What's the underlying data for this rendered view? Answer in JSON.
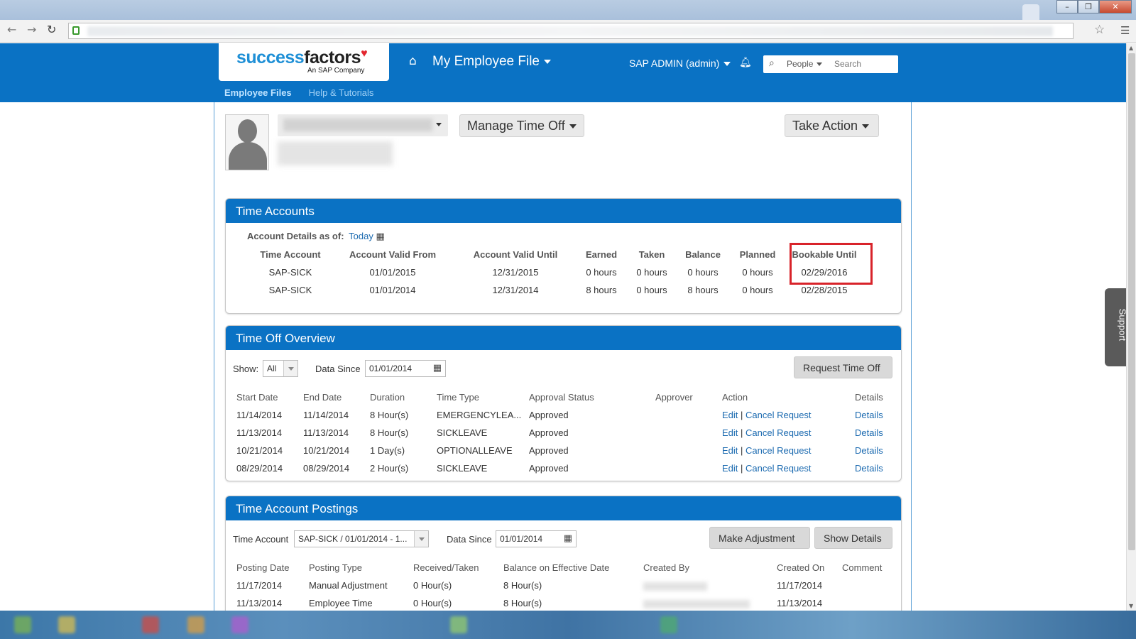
{
  "header": {
    "logo_main_a": "success",
    "logo_main_b": "factors",
    "logo_sub": "An SAP Company",
    "module_title": "My Employee File",
    "user_label": "SAP ADMIN (admin)",
    "search_scope": "People",
    "search_placeholder": "Search",
    "subnav": [
      "Employee Files",
      "Help & Tutorials"
    ]
  },
  "profile": {
    "manage_time_off": "Manage Time Off",
    "take_action": "Take Action"
  },
  "time_accounts": {
    "title": "Time Accounts",
    "as_of_label": "Account Details as of:",
    "as_of_value": "Today",
    "columns": [
      "Time Account",
      "Account Valid From",
      "Account Valid Until",
      "Earned",
      "Taken",
      "Balance",
      "Planned",
      "Bookable Until"
    ],
    "rows": [
      [
        "SAP-SICK",
        "01/01/2015",
        "12/31/2015",
        "0 hours",
        "0 hours",
        "0 hours",
        "0 hours",
        "02/29/2016"
      ],
      [
        "SAP-SICK",
        "01/01/2014",
        "12/31/2014",
        "8 hours",
        "0 hours",
        "8 hours",
        "0 hours",
        "02/28/2015"
      ]
    ]
  },
  "time_off_overview": {
    "title": "Time Off Overview",
    "show_label": "Show:",
    "show_value": "All",
    "data_since_label": "Data Since",
    "data_since_value": "01/01/2014",
    "request_button": "Request Time Off",
    "columns": [
      "Start Date",
      "End Date",
      "Duration",
      "Time Type",
      "Approval Status",
      "Approver",
      "Action",
      "Details"
    ],
    "rows": [
      {
        "start": "11/14/2014",
        "end": "11/14/2014",
        "duration": "8 Hour(s)",
        "type": "EMERGENCYLEA...",
        "status": "Approved",
        "approver": "",
        "edit": "Edit",
        "sep": "|",
        "cancel": "Cancel Request",
        "details": "Details"
      },
      {
        "start": "11/13/2014",
        "end": "11/13/2014",
        "duration": "8 Hour(s)",
        "type": "SICKLEAVE",
        "status": "Approved",
        "approver": "",
        "edit": "Edit",
        "sep": "|",
        "cancel": "Cancel Request",
        "details": "Details"
      },
      {
        "start": "10/21/2014",
        "end": "10/21/2014",
        "duration": "1 Day(s)",
        "type": "OPTIONALLEAVE",
        "status": "Approved",
        "approver": "",
        "edit": "Edit",
        "sep": "|",
        "cancel": "Cancel Request",
        "details": "Details"
      },
      {
        "start": "08/29/2014",
        "end": "08/29/2014",
        "duration": "2 Hour(s)",
        "type": "SICKLEAVE",
        "status": "Approved",
        "approver": "",
        "edit": "Edit",
        "sep": "|",
        "cancel": "Cancel Request",
        "details": "Details"
      }
    ]
  },
  "postings": {
    "title": "Time Account Postings",
    "account_label": "Time Account",
    "account_value": "SAP-SICK / 01/01/2014 - 1...",
    "data_since_label": "Data Since",
    "data_since_value": "01/01/2014",
    "make_adjustment": "Make Adjustment",
    "show_details": "Show Details",
    "columns": [
      "Posting Date",
      "Posting Type",
      "Received/Taken",
      "Balance on Effective Date",
      "Created By",
      "Created On",
      "Comment"
    ],
    "rows": [
      {
        "date": "11/17/2014",
        "type": "Manual Adjustment",
        "received": "0 Hour(s)",
        "balance": "8 Hour(s)",
        "created_on": "11/17/2014",
        "comment": ""
      },
      {
        "date": "11/13/2014",
        "type": "Employee Time",
        "received": "0 Hour(s)",
        "balance": "8 Hour(s)",
        "created_on": "11/13/2014",
        "comment": ""
      }
    ]
  },
  "support_label": "Support",
  "colors": {
    "brand_blue": "#0a72c4",
    "link": "#1b6ab0",
    "highlight": "#d8232a"
  }
}
